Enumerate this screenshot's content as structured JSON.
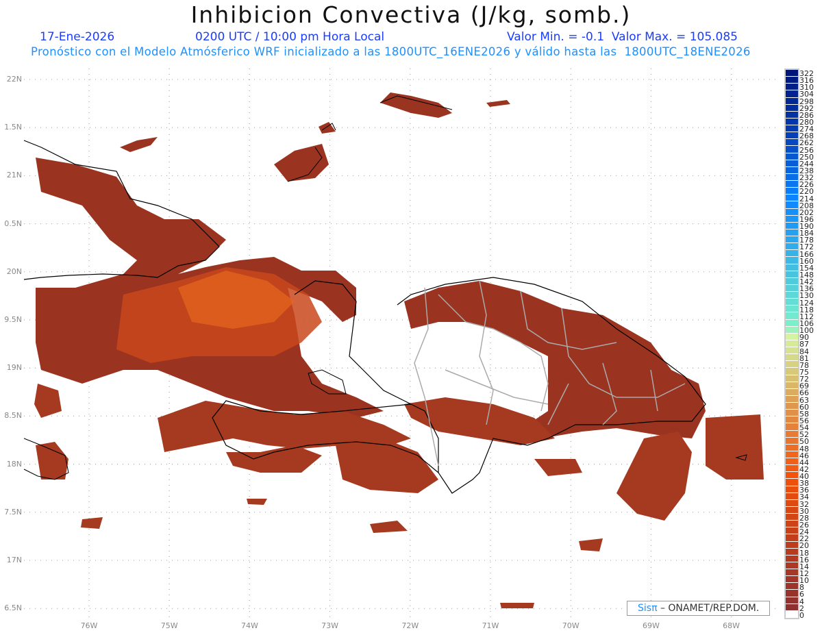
{
  "header": {
    "title": "Inhibicion Convectiva (J/kg, somb.)",
    "date": "17-Ene-2026",
    "time": "0200 UTC / 10:00 pm Hora Local",
    "minmax": "Valor Min. = -0.1  Valor Max. = 105.085",
    "subtitle": "Pronóstico con el Modelo Atmósferico WRF inicializado a las 1800UTC_16ENE2026 y válido hasta las  1800UTC_18ENE2026"
  },
  "axes": {
    "lat_labels": [
      "22N",
      "1.5N",
      "21N",
      "0.5N",
      "20N",
      "9.5N",
      "19N",
      "8.5N",
      "18N",
      "7.5N",
      "17N",
      "6.5N"
    ],
    "lon_labels": [
      "76W",
      "75W",
      "74W",
      "73W",
      "72W",
      "71W",
      "70W",
      "69W",
      "68W"
    ]
  },
  "colorbar": {
    "labels": [
      "322",
      "316",
      "310",
      "304",
      "298",
      "292",
      "286",
      "280",
      "274",
      "268",
      "262",
      "256",
      "250",
      "244",
      "238",
      "232",
      "226",
      "220",
      "214",
      "208",
      "202",
      "196",
      "190",
      "184",
      "178",
      "172",
      "166",
      "160",
      "154",
      "148",
      "142",
      "136",
      "130",
      "124",
      "118",
      "112",
      "106",
      "100",
      "90",
      "87",
      "84",
      "81",
      "78",
      "75",
      "72",
      "69",
      "66",
      "63",
      "60",
      "58",
      "56",
      "54",
      "52",
      "50",
      "48",
      "46",
      "44",
      "42",
      "40",
      "38",
      "36",
      "34",
      "32",
      "30",
      "28",
      "26",
      "24",
      "22",
      "20",
      "18",
      "16",
      "14",
      "12",
      "10",
      "8",
      "6",
      "4",
      "2",
      "0"
    ],
    "color_stops": [
      {
        "v": 322,
        "c": "#00157a"
      },
      {
        "v": 268,
        "c": "#0440b8"
      },
      {
        "v": 214,
        "c": "#0a84ff"
      },
      {
        "v": 160,
        "c": "#3cb8e4"
      },
      {
        "v": 106,
        "c": "#78f0cc"
      },
      {
        "v": 90,
        "c": "#d4f4a0"
      },
      {
        "v": 72,
        "c": "#d8c070"
      },
      {
        "v": 58,
        "c": "#e09048"
      },
      {
        "v": 40,
        "c": "#f4520a"
      },
      {
        "v": 20,
        "c": "#bc3c1c"
      },
      {
        "v": 2,
        "c": "#8e3030"
      }
    ]
  },
  "credit": {
    "brand": "Sisπ",
    "text": " –  ONAMET/REP.DOM."
  }
}
